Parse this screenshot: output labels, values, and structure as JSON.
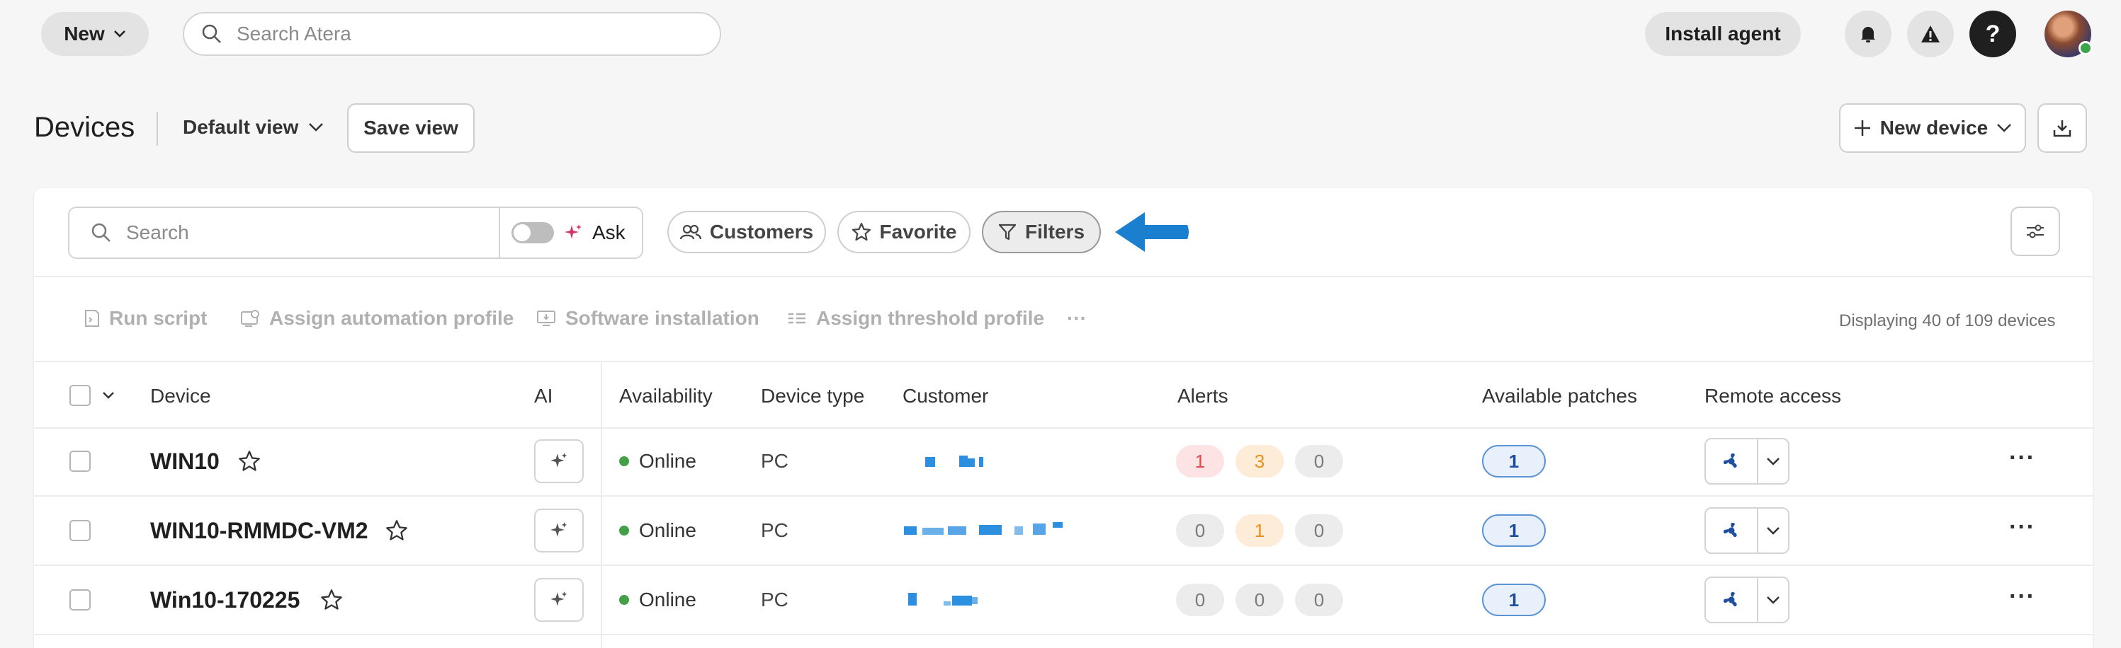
{
  "topbar": {
    "new_label": "New",
    "search_placeholder": "Search Atera",
    "install_label": "Install agent",
    "icons": [
      "bell-icon",
      "warning-icon",
      "help-icon"
    ]
  },
  "header": {
    "title": "Devices",
    "view_label": "Default view",
    "save_view_label": "Save view",
    "new_device_label": "New device"
  },
  "toolbar": {
    "search_placeholder": "Search",
    "ask_label": "Ask",
    "chips": {
      "customers": "Customers",
      "favorite": "Favorite",
      "filters": "Filters"
    }
  },
  "actions": {
    "run_script": "Run script",
    "assign_automation": "Assign automation profile",
    "software_installation": "Software installation",
    "assign_threshold": "Assign threshold profile",
    "more": "···",
    "displaying": "Displaying 40 of 109 devices"
  },
  "table": {
    "headers": {
      "device": "Device",
      "ai": "AI",
      "availability": "Availability",
      "device_type": "Device type",
      "customer": "Customer",
      "alerts": "Alerts",
      "patches": "Available patches",
      "remote": "Remote access"
    },
    "rows": [
      {
        "name": "WIN10",
        "availability": "Online",
        "type": "PC",
        "alerts": [
          "1",
          "3",
          "0"
        ],
        "patches": "1"
      },
      {
        "name": "WIN10-RMMDC-VM2",
        "availability": "Online",
        "type": "PC",
        "alerts": [
          "0",
          "1",
          "0"
        ],
        "patches": "1"
      },
      {
        "name": "Win10-170225",
        "availability": "Online",
        "type": "PC",
        "alerts": [
          "0",
          "0",
          "0"
        ],
        "patches": "1"
      }
    ]
  },
  "colors": {
    "accent_arrow": "#1a7fcf",
    "online": "#43a047",
    "alert_critical": "#e24b4b",
    "alert_warning": "#e8901b"
  }
}
